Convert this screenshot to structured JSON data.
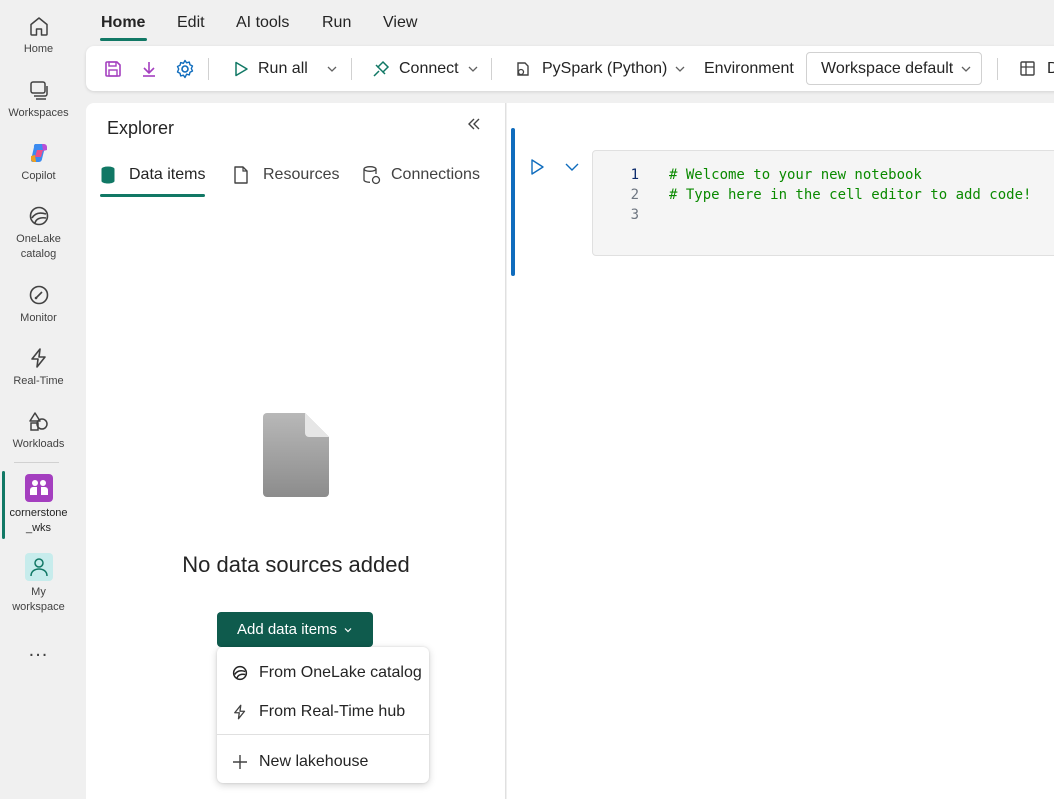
{
  "rail": {
    "items": [
      {
        "label": "Home",
        "icon": "home-icon"
      },
      {
        "label": "Workspaces",
        "icon": "workspaces-icon"
      },
      {
        "label": "Copilot",
        "icon": "copilot-icon"
      },
      {
        "label": "OneLake catalog",
        "icon": "onelake-icon"
      },
      {
        "label": "Monitor",
        "icon": "monitor-icon"
      },
      {
        "label": "Real-Time",
        "icon": "realtime-icon"
      },
      {
        "label": "Workloads",
        "icon": "workloads-icon"
      },
      {
        "label": "cornerstone _wks",
        "icon": "workspace-badge-icon"
      },
      {
        "label": "My workspace",
        "icon": "my-workspace-icon"
      }
    ],
    "more": "..."
  },
  "menu": {
    "items": [
      "Home",
      "Edit",
      "AI tools",
      "Run",
      "View"
    ],
    "active": "Home"
  },
  "toolbar": {
    "run_all": "Run all",
    "connect": "Connect",
    "language": "PySpark (Python)",
    "environment_label": "Environment",
    "environment_value": "Workspace default",
    "truncated_label": "D"
  },
  "explorer": {
    "title": "Explorer",
    "tabs": [
      "Data items",
      "Resources",
      "Connections"
    ],
    "active_tab": "Data items",
    "empty_message": "No data sources added",
    "add_button": "Add data items",
    "dropdown": [
      "From OneLake catalog",
      "From Real-Time hub",
      "New lakehouse"
    ]
  },
  "notebook": {
    "line_numbers": [
      "1",
      "2",
      "3"
    ],
    "code_lines": [
      "# Welcome to your new notebook",
      "# Type here in the cell editor to add code!",
      ""
    ]
  },
  "colors": {
    "accent": "#117865",
    "button": "#0f5b4d",
    "code_comment": "#0a8a00",
    "cell_active": "#0f6cbd"
  }
}
